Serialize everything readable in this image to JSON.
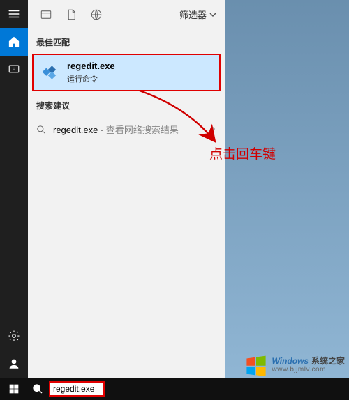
{
  "sidebar": {
    "top_items": [
      {
        "name": "menu-icon"
      },
      {
        "name": "home-icon"
      },
      {
        "name": "screen-icon"
      }
    ],
    "bottom_items": [
      {
        "name": "settings-icon"
      },
      {
        "name": "user-icon"
      }
    ]
  },
  "panel": {
    "filter_label": "筛选器",
    "best_match_label": "最佳匹配",
    "result": {
      "title": "regedit.exe",
      "subtitle": "运行命令"
    },
    "suggest_label": "搜索建议",
    "suggest": {
      "query": "regedit.exe",
      "separator": " - ",
      "hint": "查看网络搜索结果"
    }
  },
  "taskbar": {
    "search_value": "regedit.exe"
  },
  "annotation": {
    "text": "点击回车键"
  },
  "watermark": {
    "brand": "Windows",
    "suffix": "系统之家",
    "url": "www.bjjmlv.com"
  },
  "colors": {
    "accent": "#0078d7",
    "highlight_border": "#e00000",
    "selection_bg": "#cce8ff",
    "annotation": "#d00000"
  }
}
